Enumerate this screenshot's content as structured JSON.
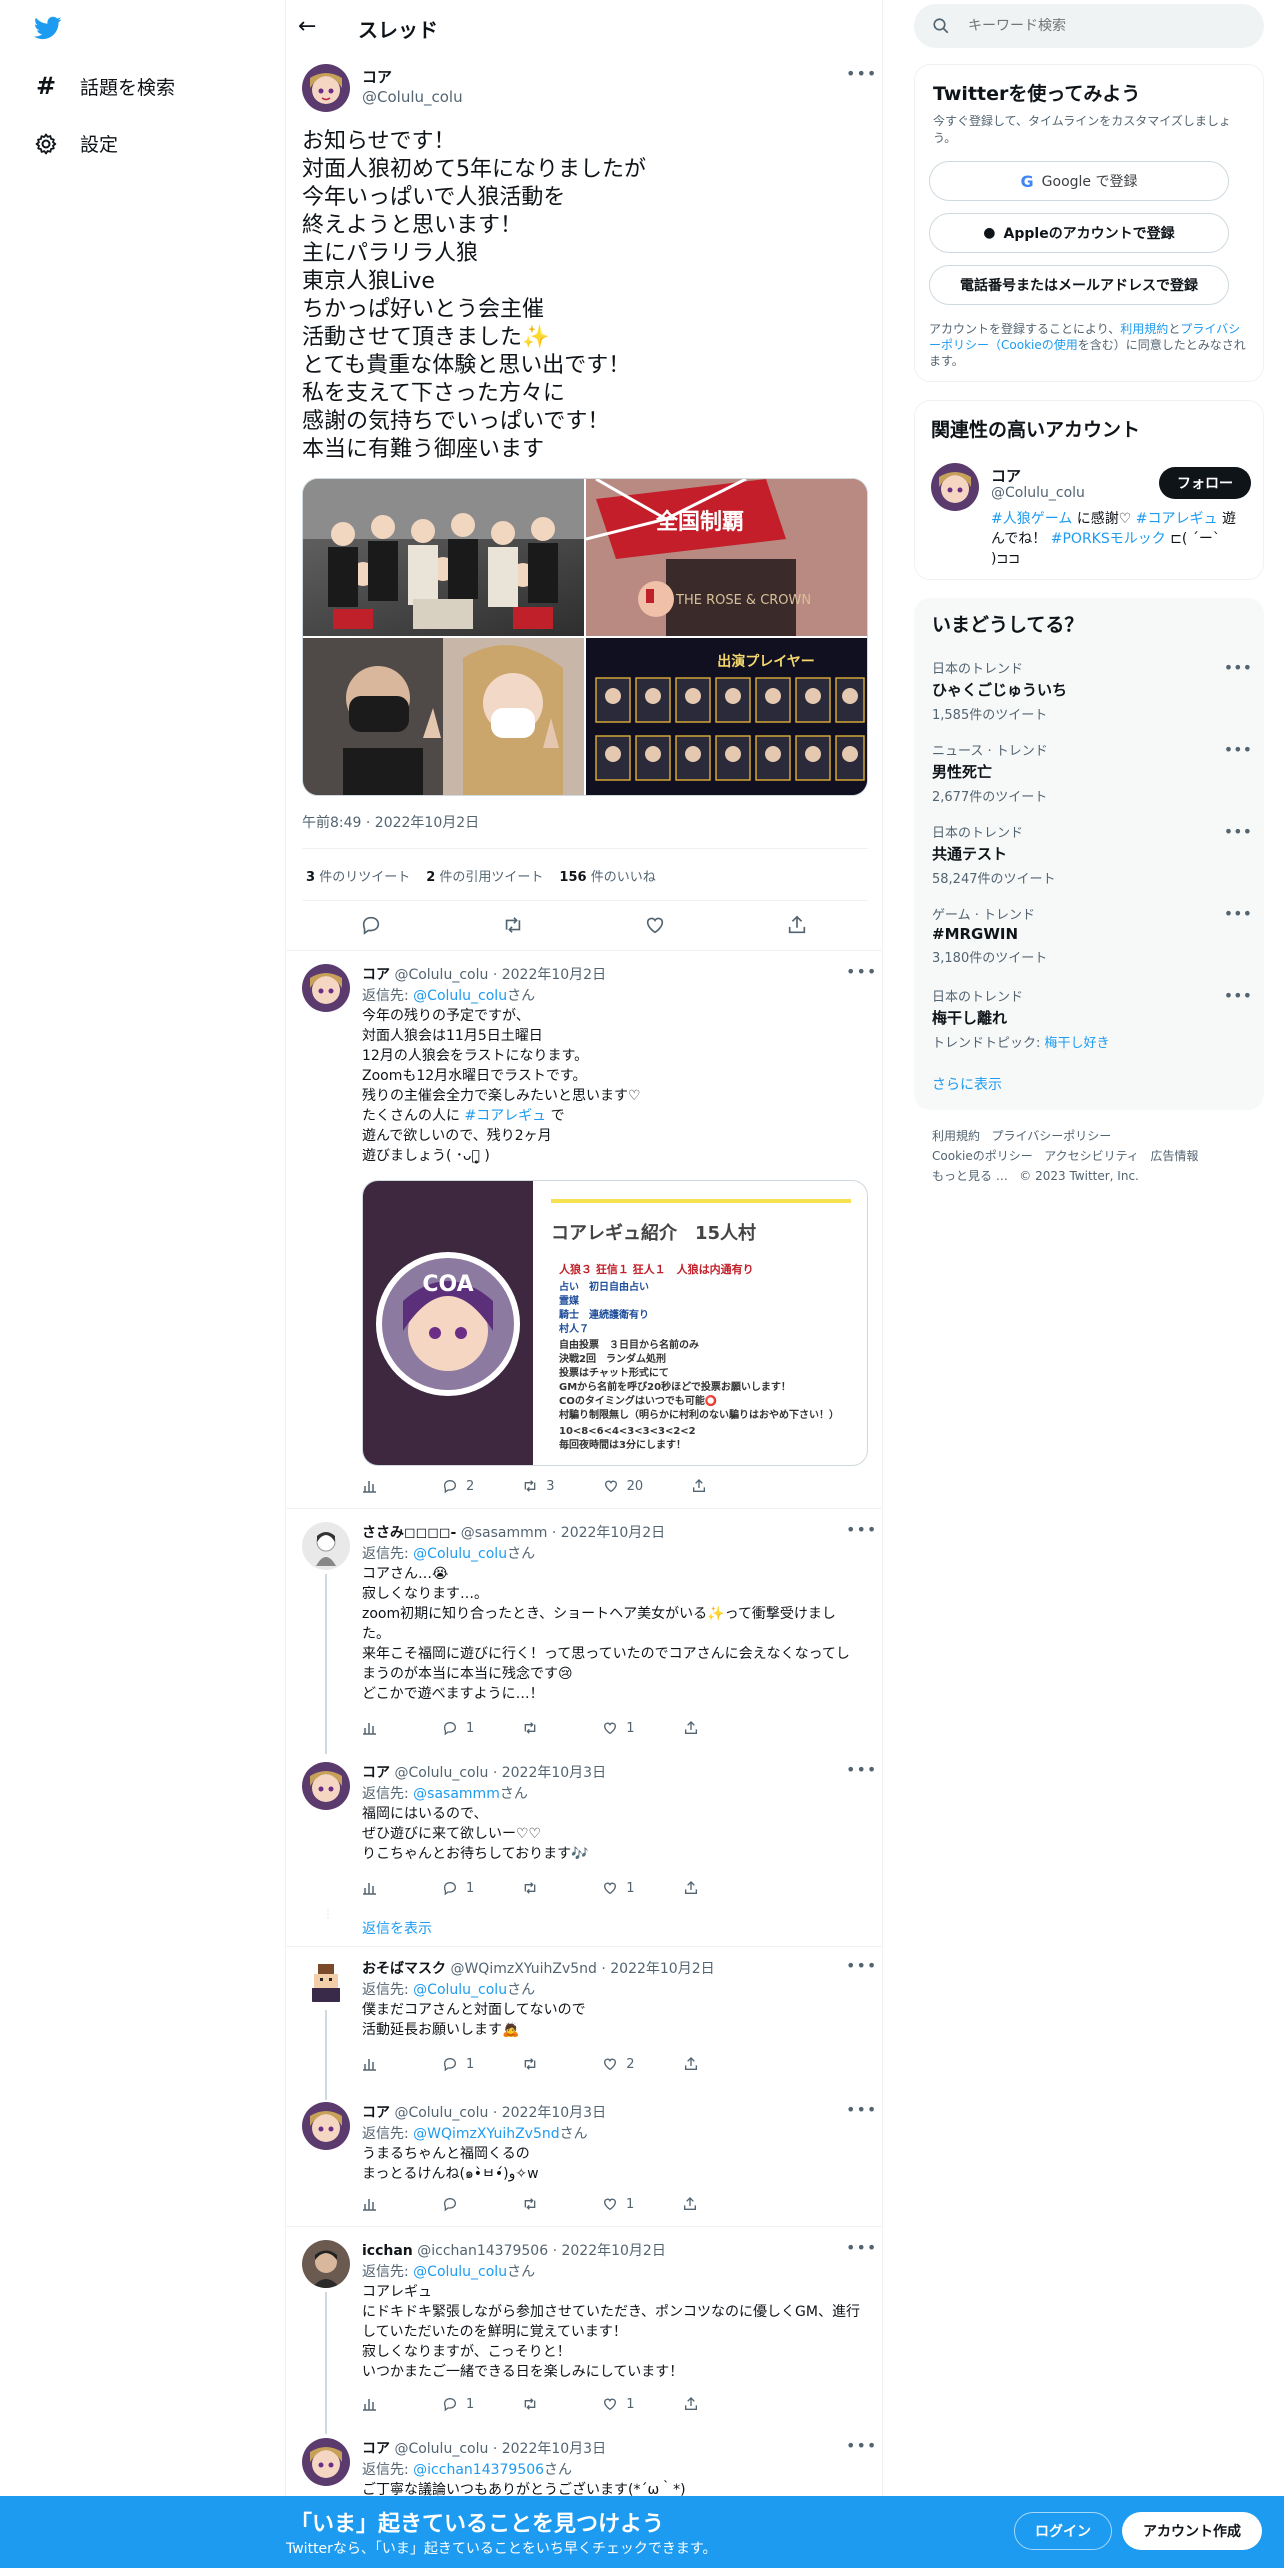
{
  "nav": {
    "explore": "話題を検索",
    "settings": "設定"
  },
  "header": {
    "title": "スレッド"
  },
  "main_tweet": {
    "name": "コア",
    "handle": "@Colulu_colu",
    "text": "お知らせです！\n対面人狼初めて5年になりましたが\n今年いっぱいで人狼活動を\n終えようと思います！\n主にパラリラ人狼\n東京人狼Live\nちかっぱ好いとう会主催\n活動させて頂きました✨\nとても貴重な体験と思い出です！\n私を支えて下さった方々に\n感謝の気持ちでいっぱいです！\n本当に有難う御座います",
    "images_text": {
      "sign_text": "全国制覇",
      "card_text": "THE ROSE & CROWN",
      "player_title": "出演プレイヤー"
    },
    "timestamp": "午前8:49 · 2022年10月2日",
    "stats": {
      "retweets_num": "3",
      "retweets_label": "件のリツイート",
      "quotes_num": "2",
      "quotes_label": "件の引用ツイート",
      "likes_num": "156",
      "likes_label": "件のいいね"
    }
  },
  "card": {
    "title": "コアレギュ紹介　15人村",
    "line1": "人狼３ 狂信１ 狂人１　人狼は内通有り",
    "roles": "占い　初日自由占い\n霊媒\n騎士　連続護衛有り\n村人７",
    "rules": "自由投票　３日目から名前のみ\n決戦2回　ランダム処刑\n投票はチャット形式にて\nGMから名前を呼び20秒ほどで投票お願いします！\nCOのタイミングはいつでも可能⭕\n村騙り制限無し（明らかに村利のない騙りはおやめ下さい！）",
    "footer": "10<8<6<4<3<3<3<2<2\n毎回夜時間は3分にします！",
    "logo_text": "COA"
  },
  "replies": [
    {
      "name": "コア",
      "handle": "@Colulu_colu",
      "date": "2022年10月2日",
      "reply_prefix": "返信先: ",
      "reply_to": "@Colulu_colu",
      "reply_suffix": "さん",
      "text_a": "今年の残りの予定ですが、\n対面人狼会は11月5日土曜日\n12月の人狼会をラストになります。\nZoomも12月水曜日でラストです。\n残りの主催会全力で楽しみたいと思います♡\nたくさんの人に ",
      "hashtag": "#コアレギュ",
      "text_b": " で\n遊んで欲しいので、残り2ヶ月\n遊びましょう( ･ᴗ･̥̥̥ )",
      "replies": "2",
      "retweets": "3",
      "likes": "20"
    },
    {
      "name": "ささみ◻◻◻◻-",
      "handle": "@sasammm",
      "date": "2022年10月2日",
      "reply_prefix": "返信先: ",
      "reply_to": "@Colulu_colu",
      "reply_suffix": "さん",
      "text": "コアさん…😭\n寂しくなります…。\nzoom初期に知り合ったとき、ショートヘア美女がいる✨って衝撃受けました。\n来年こそ福岡に遊びに行く！って思っていたのでコアさんに会えなくなってしまうのが本当に本当に残念です😢\nどこかで遊べますように…！",
      "replies": "1",
      "retweets": "",
      "likes": "1"
    },
    {
      "name": "コア",
      "handle": "@Colulu_colu",
      "date": "2022年10月3日",
      "reply_prefix": "返信先: ",
      "reply_to": "@sasammm",
      "reply_suffix": "さん",
      "text": "福岡にはいるので、\nぜひ遊びに来て欲しいー♡♡\nりこちゃんとお待ちしております🎶",
      "replies": "1",
      "retweets": "",
      "likes": "1"
    },
    {
      "name": "おそばマスク",
      "handle": "@WQimzXYuihZv5nd",
      "date": "2022年10月2日",
      "reply_prefix": "返信先: ",
      "reply_to": "@Colulu_colu",
      "reply_suffix": "さん",
      "text": "僕まだコアさんと対面してないので\n活動延長お願いします🙇",
      "replies": "1",
      "retweets": "",
      "likes": "2"
    },
    {
      "name": "コア",
      "handle": "@Colulu_colu",
      "date": "2022年10月3日",
      "reply_prefix": "返信先: ",
      "reply_to": "@WQimzXYuihZv5nd",
      "reply_suffix": "さん",
      "text": "うまるちゃんと福岡くるの\nまっとるけんね(๑•̀ㅂ•́)و✧w",
      "replies": "",
      "retweets": "",
      "likes": "1"
    },
    {
      "name": "icchan",
      "handle": "@icchan14379506",
      "date": "2022年10月2日",
      "reply_prefix": "返信先: ",
      "reply_to": "@Colulu_colu",
      "reply_suffix": "さん",
      "text": "コアレギュ\nにドキドキ緊張しながら参加させていただき、ポンコツなのに優しくGM、進行していただいたのを鮮明に覚えています！\n寂しくなりますが、こっそりと！\nいつかまたご一緒できる日を楽しみにしています！",
      "replies": "1",
      "retweets": "",
      "likes": "1"
    },
    {
      "name": "コア",
      "handle": "@Colulu_colu",
      "date": "2022年10月3日",
      "reply_prefix": "返信先: ",
      "reply_to": "@icchan14379506",
      "reply_suffix": "さん",
      "text": "ご丁寧な議論いつもありがとうございます(*´ω｀*)"
    }
  ],
  "show_replies": "返信を表示",
  "search": {
    "placeholder": "キーワード検索"
  },
  "signup": {
    "title": "Twitterを使ってみよう",
    "desc": "今すぐ登録して、タイムラインをカスタマイズしましょう。",
    "google": "Google で登録",
    "apple": "Appleのアカウントで登録",
    "phone": "電話番号またはメールアドレスで登録",
    "terms_a": "アカウントを登録することにより、",
    "terms_link1": "利用規約",
    "terms_b": "と",
    "terms_link2": "プライバシーポリシー（Cookieの使用",
    "terms_c": "を含む）に同意したとみなされます。"
  },
  "related": {
    "title": "関連性の高いアカウント",
    "name": "コア",
    "handle": "@Colulu_colu",
    "follow": "フォロー",
    "bio_tag1": "#人狼ゲーム",
    "bio_t1": " に感謝♡ ",
    "bio_tag2": "#コアレギュ",
    "bio_t2": " 遊んでね！ ",
    "bio_tag3": "#PORKSモルック",
    "bio_t3": " ⊏( ´ー` )⊐⊐"
  },
  "trends": {
    "title": "いまどうしてる？",
    "items": [
      {
        "category": "日本のトレンド",
        "name": "ひゃくごじゅういち",
        "count": "1,585件のツイート"
      },
      {
        "category": "ニュース · トレンド",
        "name": "男性死亡",
        "count": "2,677件のツイート"
      },
      {
        "category": "日本のトレンド",
        "name": "共通テスト",
        "count": "58,247件のツイート"
      },
      {
        "category": "ゲーム · トレンド",
        "name": "#MRGWIN",
        "count": "3,180件のツイート"
      },
      {
        "category": "日本のトレンド",
        "name": "梅干し離れ",
        "count_prefix": "トレンドトピック: ",
        "count_link": "梅干し好き"
      }
    ],
    "more": "さらに表示"
  },
  "footer_links": {
    "l1": "利用規約",
    "l2": "プライバシーポリシー",
    "l3": "Cookieのポリシー",
    "l4": "アクセシビリティ",
    "l5": "広告情報",
    "l6": "もっと見る …",
    "copyright": "© 2023 Twitter, Inc."
  },
  "bottom_bar": {
    "title": "「いま」起きていることを見つけよう",
    "subtitle": "Twitterなら、「いま」起きていることをいち早くチェックできます。",
    "login": "ログイン",
    "signup": "アカウント作成"
  },
  "colors": {
    "brand": "#1d9bf0",
    "banner": "#1d9bf0"
  }
}
